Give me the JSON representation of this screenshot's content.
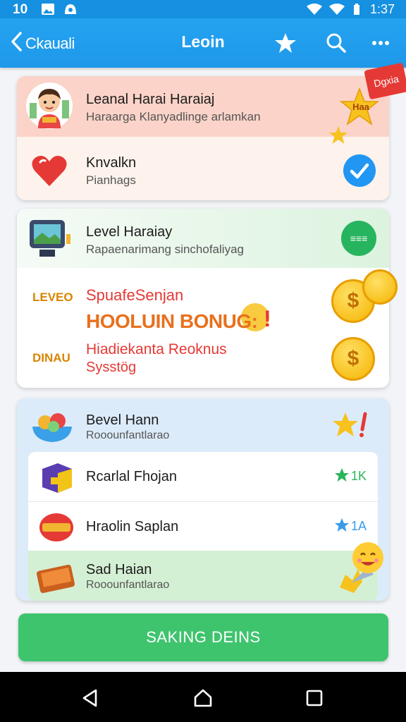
{
  "status_bar": {
    "time_left": "10",
    "time_right": "1:37"
  },
  "app_bar": {
    "back_label": "Ckauali",
    "title": "Leoin"
  },
  "profile_card": {
    "title": "Leanal Harai Haraiaj",
    "subtitle": "Haraarga Klanyadlinge arlamkan",
    "badge_star": "Haa",
    "corner_tag": "Dgxia"
  },
  "favorite_row": {
    "title": "Knvalkn",
    "subtitle": "Pianhags"
  },
  "level_card": {
    "title": "Level Haraiay",
    "subtitle": "Rapaenarimang sinchofaliyag",
    "badge": "≡≡≡"
  },
  "bonus_section": {
    "left_label_1": "LEVEO",
    "line_1": "SpuafeSenjan",
    "headline": "HOOLUIN BONUG:",
    "exclaim": "!",
    "left_label_2": "DINAU",
    "line_3": "Hiadiekanta Reoknus",
    "line_4": "Sysstög",
    "coin_symbol_1": "$",
    "coin_symbol_2": "$"
  },
  "list_card": {
    "header_title": "Bevel Hann",
    "header_subtitle": "Rooounfantlarao",
    "items": [
      {
        "title": "Rcarlal Fhojan",
        "count": "1K",
        "star_color": "#2bb55a"
      },
      {
        "title": "Hraolin Saplan",
        "count": "1A",
        "star_color": "#3a9be8"
      },
      {
        "title": "Sad Haian",
        "subtitle": "Rooounfantlarao"
      }
    ]
  },
  "cta": {
    "label": "SAKING DEINS"
  },
  "colors": {
    "primary": "#1f98ea",
    "cta": "#3ec46d",
    "accent_red": "#e53935",
    "coin": "#f5b400"
  },
  "icons": {
    "status": [
      "sim-icon",
      "image-icon",
      "app-icon",
      "wifi-icon",
      "signal-icon",
      "battery-icon"
    ],
    "app_bar": [
      "back-icon",
      "star-icon",
      "search-icon",
      "more-icon"
    ],
    "nav": [
      "nav-back-icon",
      "nav-home-icon",
      "nav-recents-icon"
    ]
  }
}
